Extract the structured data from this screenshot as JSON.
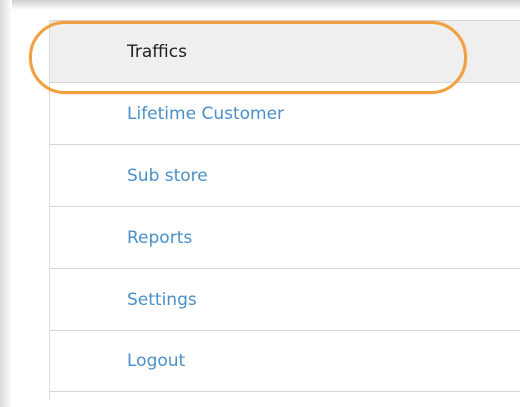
{
  "menu": {
    "items": [
      {
        "label": "Traffics",
        "active": true
      },
      {
        "label": "Lifetime Customer",
        "active": false
      },
      {
        "label": "Sub store",
        "active": false
      },
      {
        "label": "Reports",
        "active": false
      },
      {
        "label": "Settings",
        "active": false
      },
      {
        "label": "Logout",
        "active": false
      }
    ]
  },
  "colors": {
    "link": "#4a8fc7",
    "active_text": "#222222",
    "active_bg": "#efefef",
    "highlight": "#f0a040",
    "divider": "#d6d6d6"
  }
}
